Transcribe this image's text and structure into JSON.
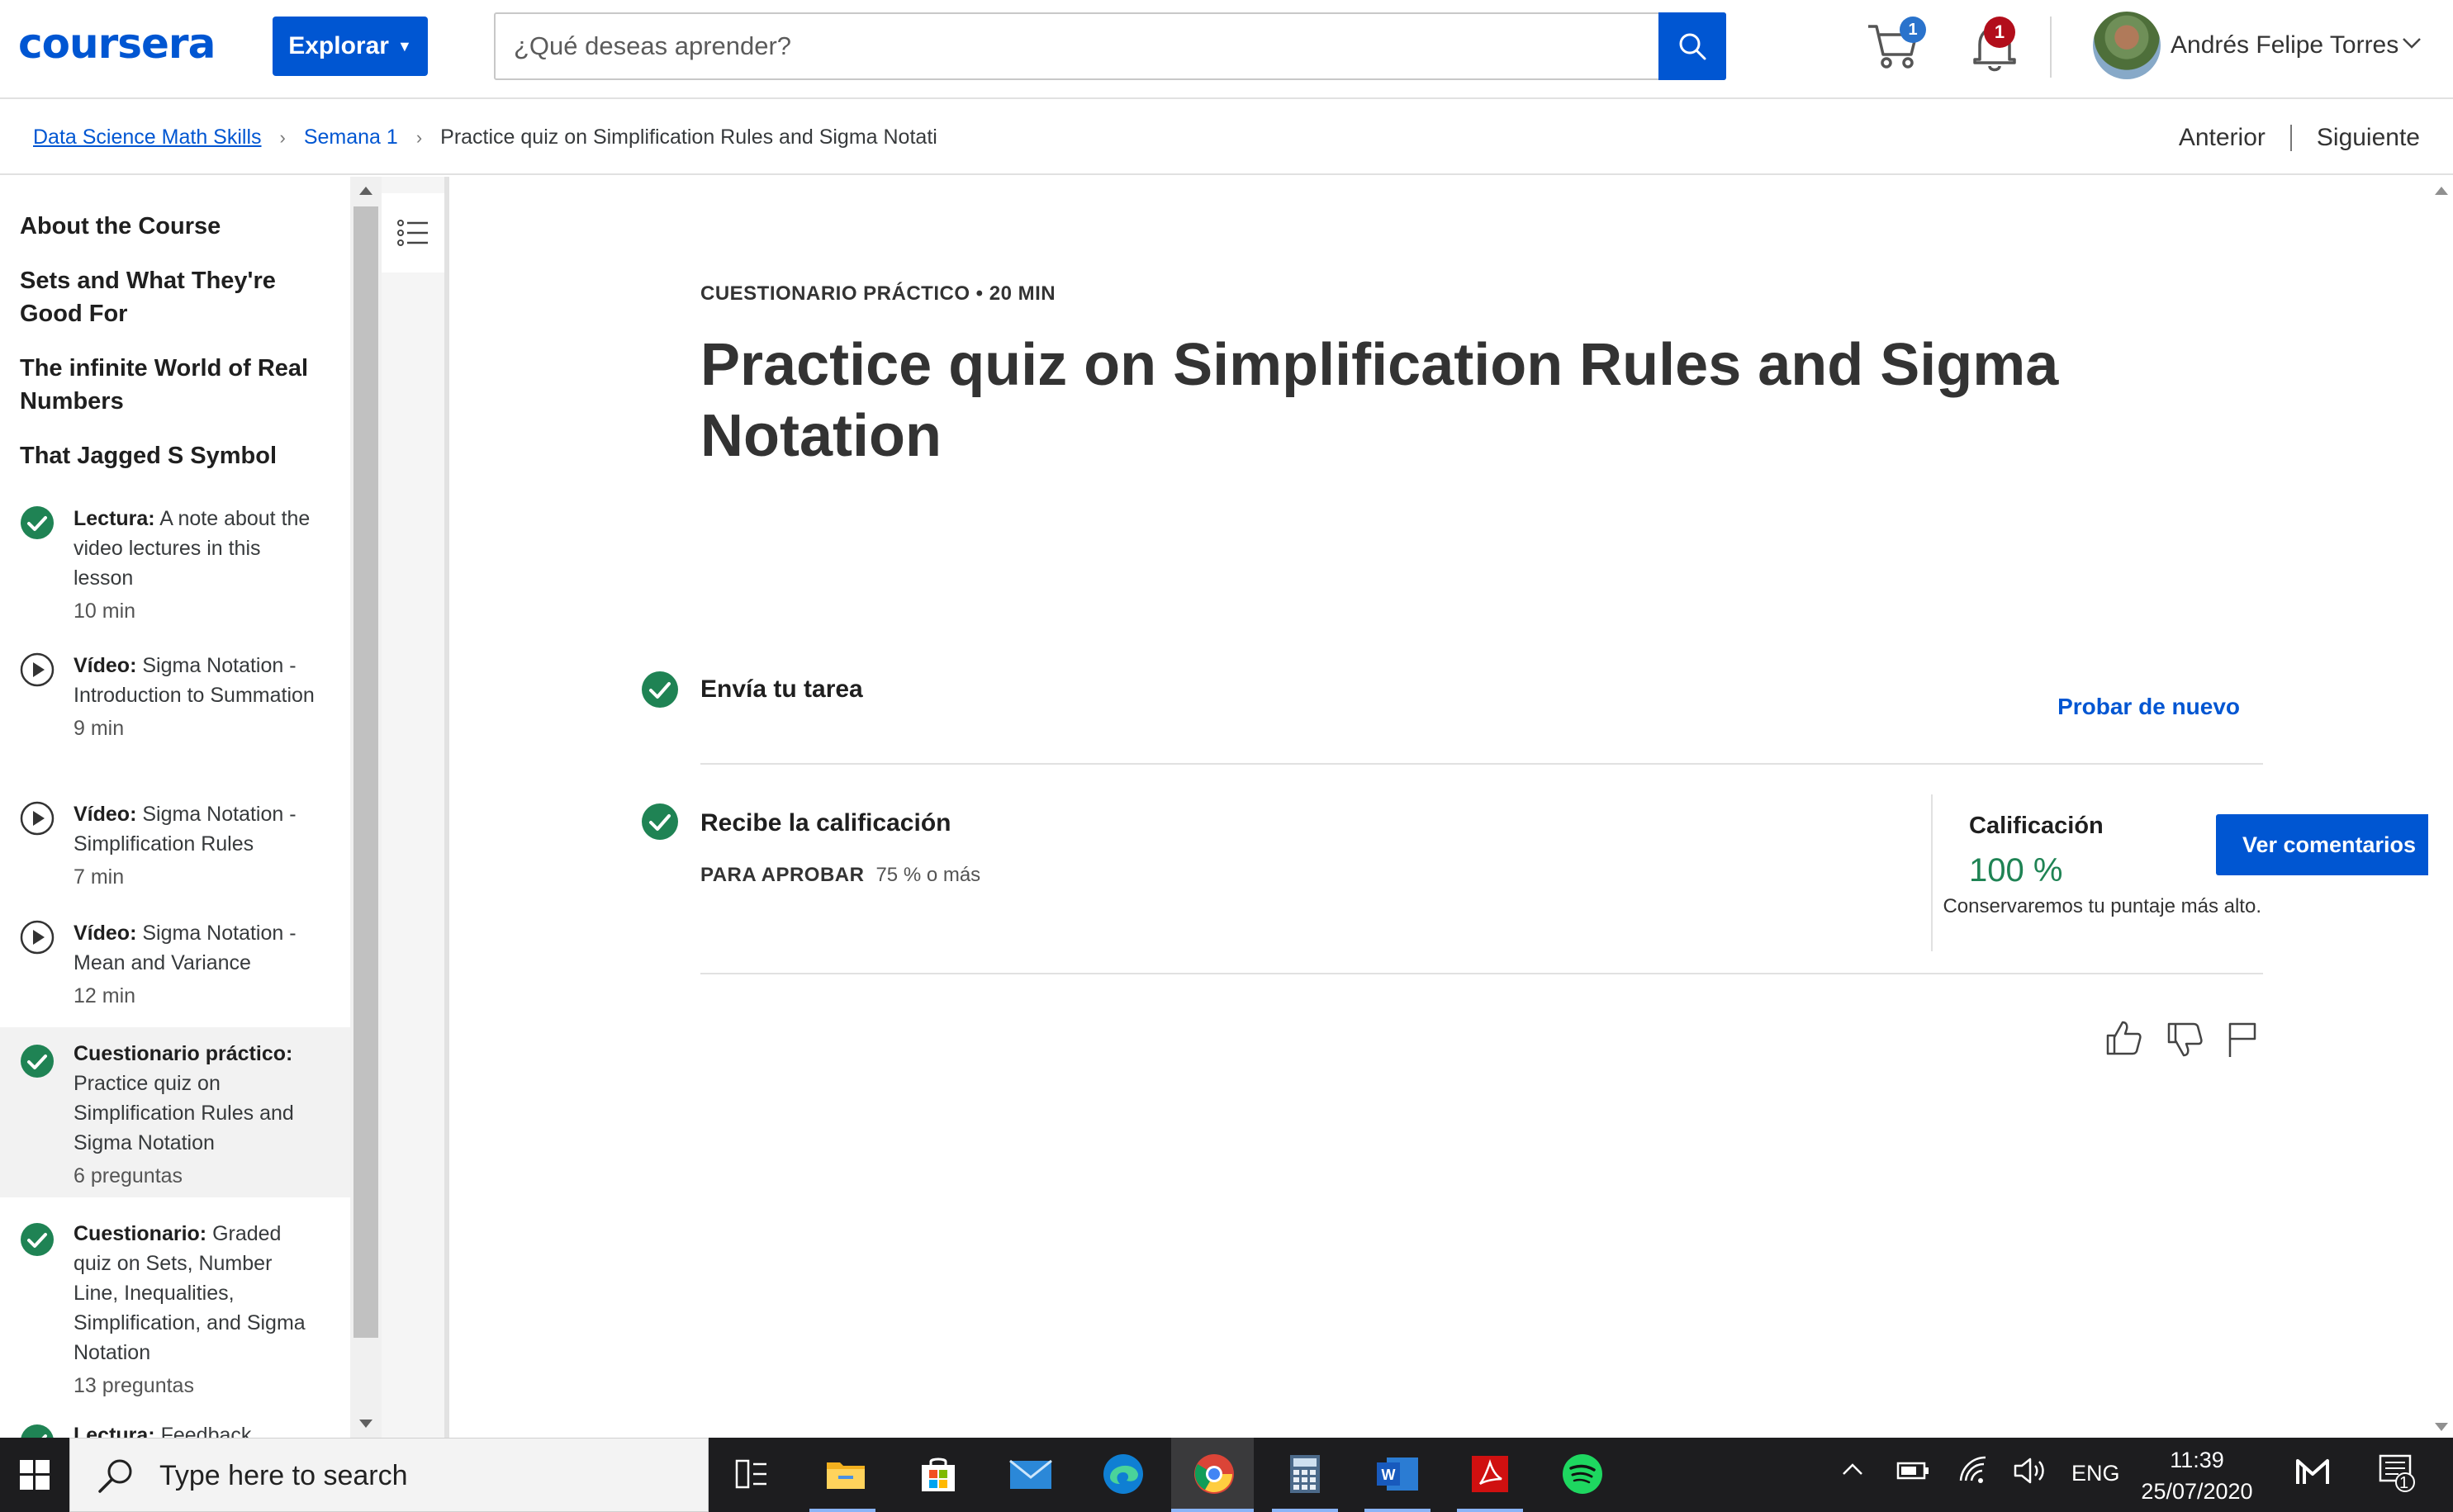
{
  "header": {
    "logo": "coursera",
    "explore_label": "Explorar",
    "search_placeholder": "¿Qué deseas aprender?",
    "cart_count": "1",
    "notifications_count": "1",
    "user_name": "Andrés Felipe Torres"
  },
  "breadcrumb": {
    "course": "Data Science Math Skills",
    "week": "Semana 1",
    "current": "Practice quiz on Simplification Rules and Sigma Notati"
  },
  "nav": {
    "prev": "Anterior",
    "next": "Siguiente"
  },
  "sidebar": {
    "headings": [
      "About the Course",
      "Sets and What They're Good For",
      "The infinite World of Real Numbers",
      "That Jagged S Symbol"
    ],
    "items": [
      {
        "type": "Lectura:",
        "title": "A note about the video lectures in this lesson",
        "meta": "10 min",
        "icon": "check-circle-icon"
      },
      {
        "type": "Vídeo:",
        "title": "Sigma Notation - Introduction to Summation",
        "meta": "9 min",
        "icon": "play-circle-icon"
      },
      {
        "type": "Vídeo:",
        "title": "Sigma Notation - Simplification Rules",
        "meta": "7 min",
        "icon": "play-circle-icon"
      },
      {
        "type": "Vídeo:",
        "title": "Sigma Notation - Mean and Variance",
        "meta": "12 min",
        "icon": "play-circle-icon"
      },
      {
        "type": "Cuestionario práctico:",
        "title": "Practice quiz on Simplification Rules and Sigma Notation",
        "meta": "6 preguntas",
        "icon": "check-circle-icon"
      },
      {
        "type": "Cuestionario:",
        "title": "Graded quiz on Sets, Number Line, Inequalities, Simplification, and Sigma Notation",
        "meta": "13 preguntas",
        "icon": "check-circle-icon"
      },
      {
        "type": "Lectura:",
        "title": "Feedback",
        "meta": "",
        "icon": "check-circle-icon"
      }
    ]
  },
  "main": {
    "kicker": "CUESTIONARIO PRÁCTICO • 20 MIN",
    "title": "Practice quiz on Simplification Rules and Sigma Notation",
    "submit_label": "Envía tu tarea",
    "retry_label": "Probar de nuevo",
    "receive_label": "Recibe la calificación",
    "pass_label": "PARA APROBAR",
    "pass_value": "75 % o más",
    "grade_label": "Calificación",
    "grade_value": "100 %",
    "view_feedback": "Ver comentarios",
    "keep_note": "Conservaremos tu puntaje más alto."
  },
  "taskbar": {
    "search_placeholder": "Type here to search",
    "language": "ENG",
    "time": "11:39",
    "date": "25/07/2020",
    "notification_count": "1"
  },
  "colors": {
    "brand": "#0056d2",
    "success": "#1f8354",
    "badge_red": "#b20e1b"
  }
}
